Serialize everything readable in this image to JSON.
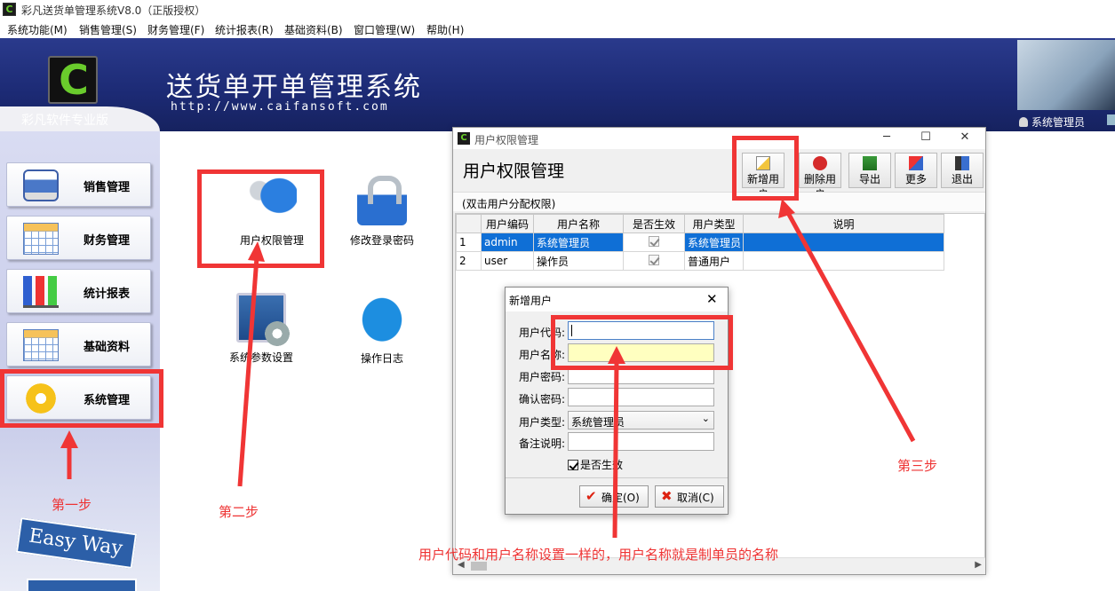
{
  "window": {
    "title": "彩凡送货单管理系统V8.0（正版授权）",
    "app_icon": "C"
  },
  "menu": [
    "系统功能(M)",
    "销售管理(S)",
    "财务管理(F)",
    "统计报表(R)",
    "基础资料(B)",
    "窗口管理(W)",
    "帮助(H)"
  ],
  "banner": {
    "logo_letter": "C",
    "brand": "彩凡软件专业版",
    "system_name": "送货单开单管理系统",
    "url": "http://www.caifansoft.com",
    "user": "系统管理员"
  },
  "sidebar": [
    {
      "label": "销售管理",
      "icon": "printer-icon"
    },
    {
      "label": "财务管理",
      "icon": "spreadsheet-icon"
    },
    {
      "label": "统计报表",
      "icon": "bar-chart-icon"
    },
    {
      "label": "基础资料",
      "icon": "spreadsheet-icon"
    },
    {
      "label": "系统管理",
      "icon": "gear-icon"
    }
  ],
  "easy_way": "Easy Way",
  "desktop_icons": [
    {
      "label": "用户权限管理",
      "icon": "keys-icon"
    },
    {
      "label": "修改登录密码",
      "icon": "padlock-icon"
    },
    {
      "label": "系统参数设置",
      "icon": "monitor-gear-icon"
    },
    {
      "label": "操作日志",
      "icon": "chat-bubble-icon"
    }
  ],
  "annotations": {
    "step1": "第一步",
    "step2": "第二步",
    "step3": "第三步",
    "note": "用户代码和用户名称设置一样的，用户名称就是制单员的名称",
    "color": "#f03535"
  },
  "perm_window": {
    "title": "用户权限管理",
    "heading": "用户权限管理",
    "hint": "(双击用户分配权限)",
    "toolbar": [
      "新增用户",
      "删除用户",
      "导出",
      "更多",
      "退出"
    ],
    "columns": [
      "用户编码",
      "用户名称",
      "是否生效",
      "用户类型",
      "说明"
    ],
    "rows": [
      {
        "no": "1",
        "code": "admin",
        "name": "系统管理员",
        "active": true,
        "type": "系统管理员",
        "note": ""
      },
      {
        "no": "2",
        "code": "user",
        "name": "操作员",
        "active": true,
        "type": "普通用户",
        "note": ""
      }
    ],
    "selected_color": "#0f6fd6"
  },
  "add_user_dialog": {
    "title": "新增用户",
    "fields": {
      "code_label": "用户代码:",
      "name_label": "用户名称:",
      "password_label": "用户密码:",
      "confirm_label": "确认密码:",
      "type_label": "用户类型:",
      "type_value": "系统管理员",
      "remark_label": "备注说明:"
    },
    "active_label": "是否生效",
    "active_checked": true,
    "ok": "确定(O)",
    "cancel": "取消(C)"
  }
}
